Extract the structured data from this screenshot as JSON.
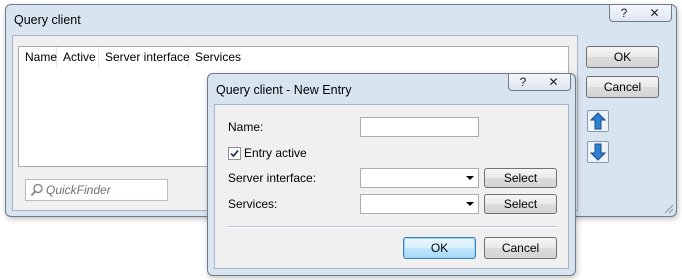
{
  "main_window": {
    "title": "Query client",
    "help_glyph": "?",
    "close_glyph": "✕",
    "columns": [
      "Name",
      "Active",
      "Server interface",
      "Services"
    ],
    "ok_label": "OK",
    "cancel_label": "Cancel",
    "quickfinder_placeholder": "QuickFinder"
  },
  "dialog": {
    "title": "Query client - New Entry",
    "help_glyph": "?",
    "close_glyph": "✕",
    "name_label": "Name:",
    "name_value": "",
    "entry_active_label": "Entry active",
    "entry_active_checked": true,
    "server_interface_label": "Server interface:",
    "server_interface_value": "",
    "services_label": "Services:",
    "services_value": "",
    "select_label": "Select",
    "ok_label": "OK",
    "cancel_label": "Cancel"
  },
  "icons": {
    "move_up": "arrow-up-icon",
    "move_down": "arrow-down-icon",
    "search": "magnifier-icon",
    "accent_arrow": "#2f7fd0"
  }
}
